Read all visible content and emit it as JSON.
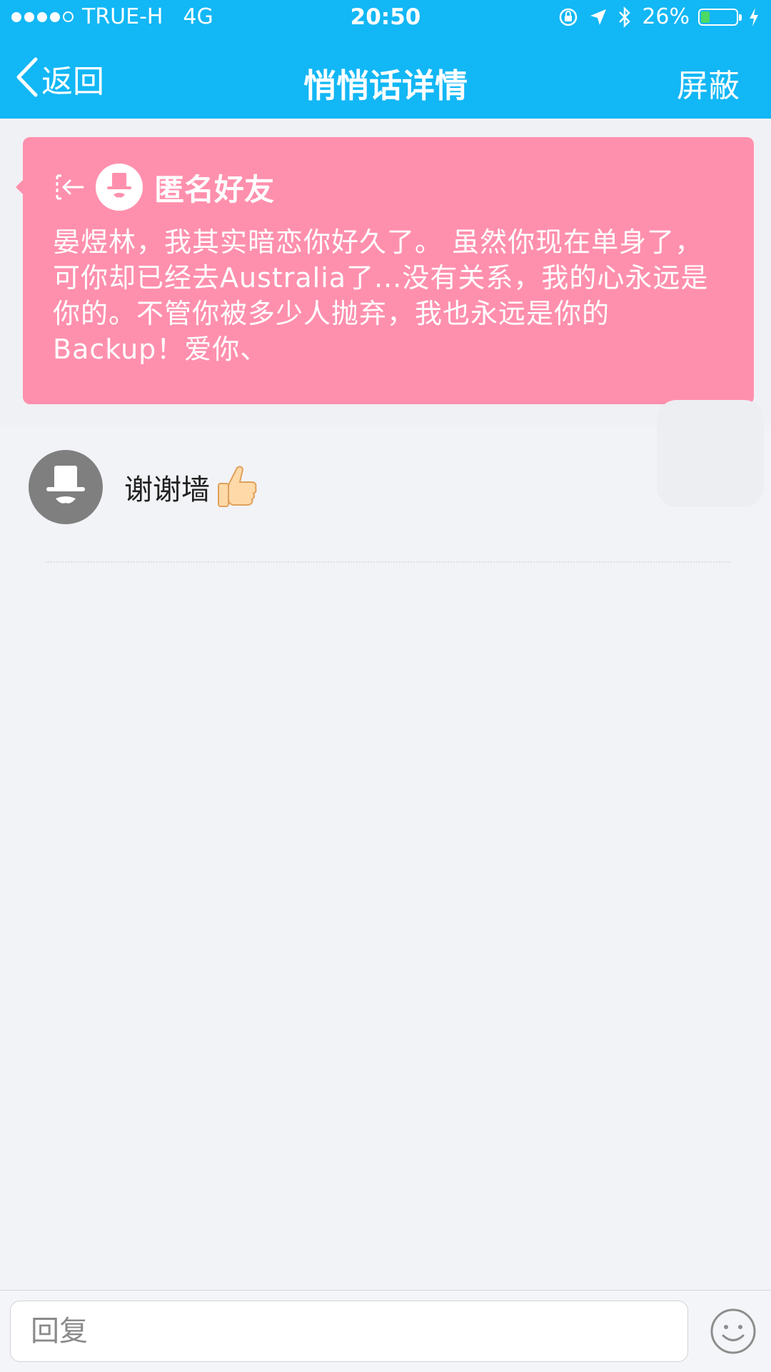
{
  "status_bar": {
    "carrier": "TRUE-H",
    "network": "4G",
    "time": "20:50",
    "battery": "26%",
    "battery_level": 0.26
  },
  "navbar": {
    "back_label": "返回",
    "title": "悄悄话详情",
    "block_label": "屏蔽"
  },
  "message_card": {
    "sender_name": "匿名好友",
    "body": "晏煜林，我其实暗恋你好久了。 虽然你现在单身了，可你却已经去Australia了...没有关系，我的心永远是你的。不管你被多少人抛弃，我也永远是你的Backup！爱你、",
    "color": "#ff90ad"
  },
  "replies": [
    {
      "text": "谢谢墙"
    }
  ],
  "input_bar": {
    "placeholder": "回复"
  },
  "colors": {
    "header": "#12b7f5",
    "background": "#f2f3f7"
  },
  "icons": [
    "back-chevron-icon",
    "exit-icon",
    "anonymous-avatar-icon",
    "thumbs-up-icon",
    "smiley-icon",
    "orientation-lock-icon",
    "location-icon",
    "bluetooth-icon",
    "charging-icon"
  ]
}
